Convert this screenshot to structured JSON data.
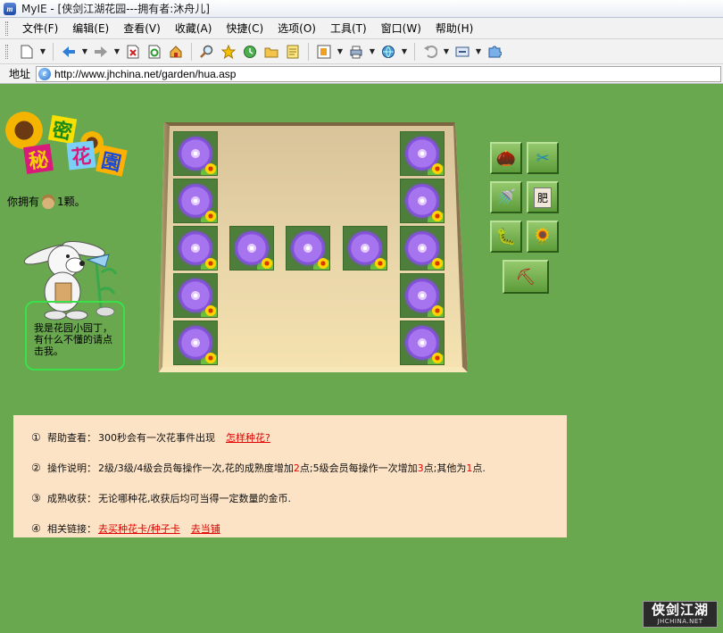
{
  "window": {
    "title": "MyIE - [侠剑江湖花园---拥有者:沐舟儿]",
    "app_icon_text": "m"
  },
  "menu": [
    "文件(F)",
    "编辑(E)",
    "查看(V)",
    "收藏(A)",
    "快捷(C)",
    "选项(O)",
    "工具(T)",
    "窗口(W)",
    "帮助(H)"
  ],
  "toolbar_icons": [
    "new-page-icon",
    "back-icon",
    "forward-icon",
    "stop-icon",
    "refresh-icon",
    "home-icon",
    "search-icon",
    "favorites-icon",
    "history-icon",
    "folder-icon",
    "notes-icon",
    "window-list-icon",
    "print-icon",
    "proxy-icon",
    "undo-icon",
    "settings-icon",
    "puzzle-icon"
  ],
  "address": {
    "label": "地址",
    "url": "http://www.jhchina.net/garden/hua.asp"
  },
  "logo": {
    "chars": [
      "秘",
      "密",
      "花",
      "園"
    ]
  },
  "inventory": {
    "prefix": "你拥有",
    "suffix": "1颗。"
  },
  "gardener": {
    "speech": "我是花园小园丁，有什么不懂的请点击我。"
  },
  "garden": {
    "grid_rows": [
      [
        1,
        0,
        0,
        0,
        1
      ],
      [
        1,
        0,
        0,
        0,
        1
      ],
      [
        1,
        1,
        1,
        1,
        1
      ],
      [
        1,
        0,
        0,
        0,
        1
      ],
      [
        1,
        0,
        0,
        0,
        1
      ]
    ]
  },
  "tools": [
    {
      "name": "seed-icon",
      "glyph": "🌰"
    },
    {
      "name": "scissors-icon",
      "glyph": "✂"
    },
    {
      "name": "watering-can-icon",
      "glyph": "🚿"
    },
    {
      "name": "fertilizer-icon",
      "glyph": "肥"
    },
    {
      "name": "bug-icon",
      "glyph": "🐛"
    },
    {
      "name": "sunflower-icon",
      "glyph": "🌻"
    },
    {
      "name": "trowel-icon",
      "glyph": "⛏"
    }
  ],
  "info": {
    "rows": [
      {
        "num": "①",
        "label": "帮助查看：",
        "text": "300秒会有一次花事件出现",
        "link": "怎样种花?"
      },
      {
        "num": "②",
        "label": "操作说明：",
        "text_a": "2级/3级/4级会员每操作一次,花的成熟度增加",
        "v1": "2",
        "text_b": "点;5级会员每操作一次增加",
        "v2": "3",
        "text_c": "点;其他为",
        "v3": "1",
        "text_d": "点."
      },
      {
        "num": "③",
        "label": "成熟收获：",
        "text": "无论哪种花,收获后均可当得一定数量的金币."
      },
      {
        "num": "④",
        "label": "相关链接：",
        "link1": "去买种花卡/种子卡",
        "link2": "去当铺"
      }
    ]
  },
  "footer_logo": {
    "big": "侠剑江湖",
    "small": "JHCHINA.NET"
  }
}
